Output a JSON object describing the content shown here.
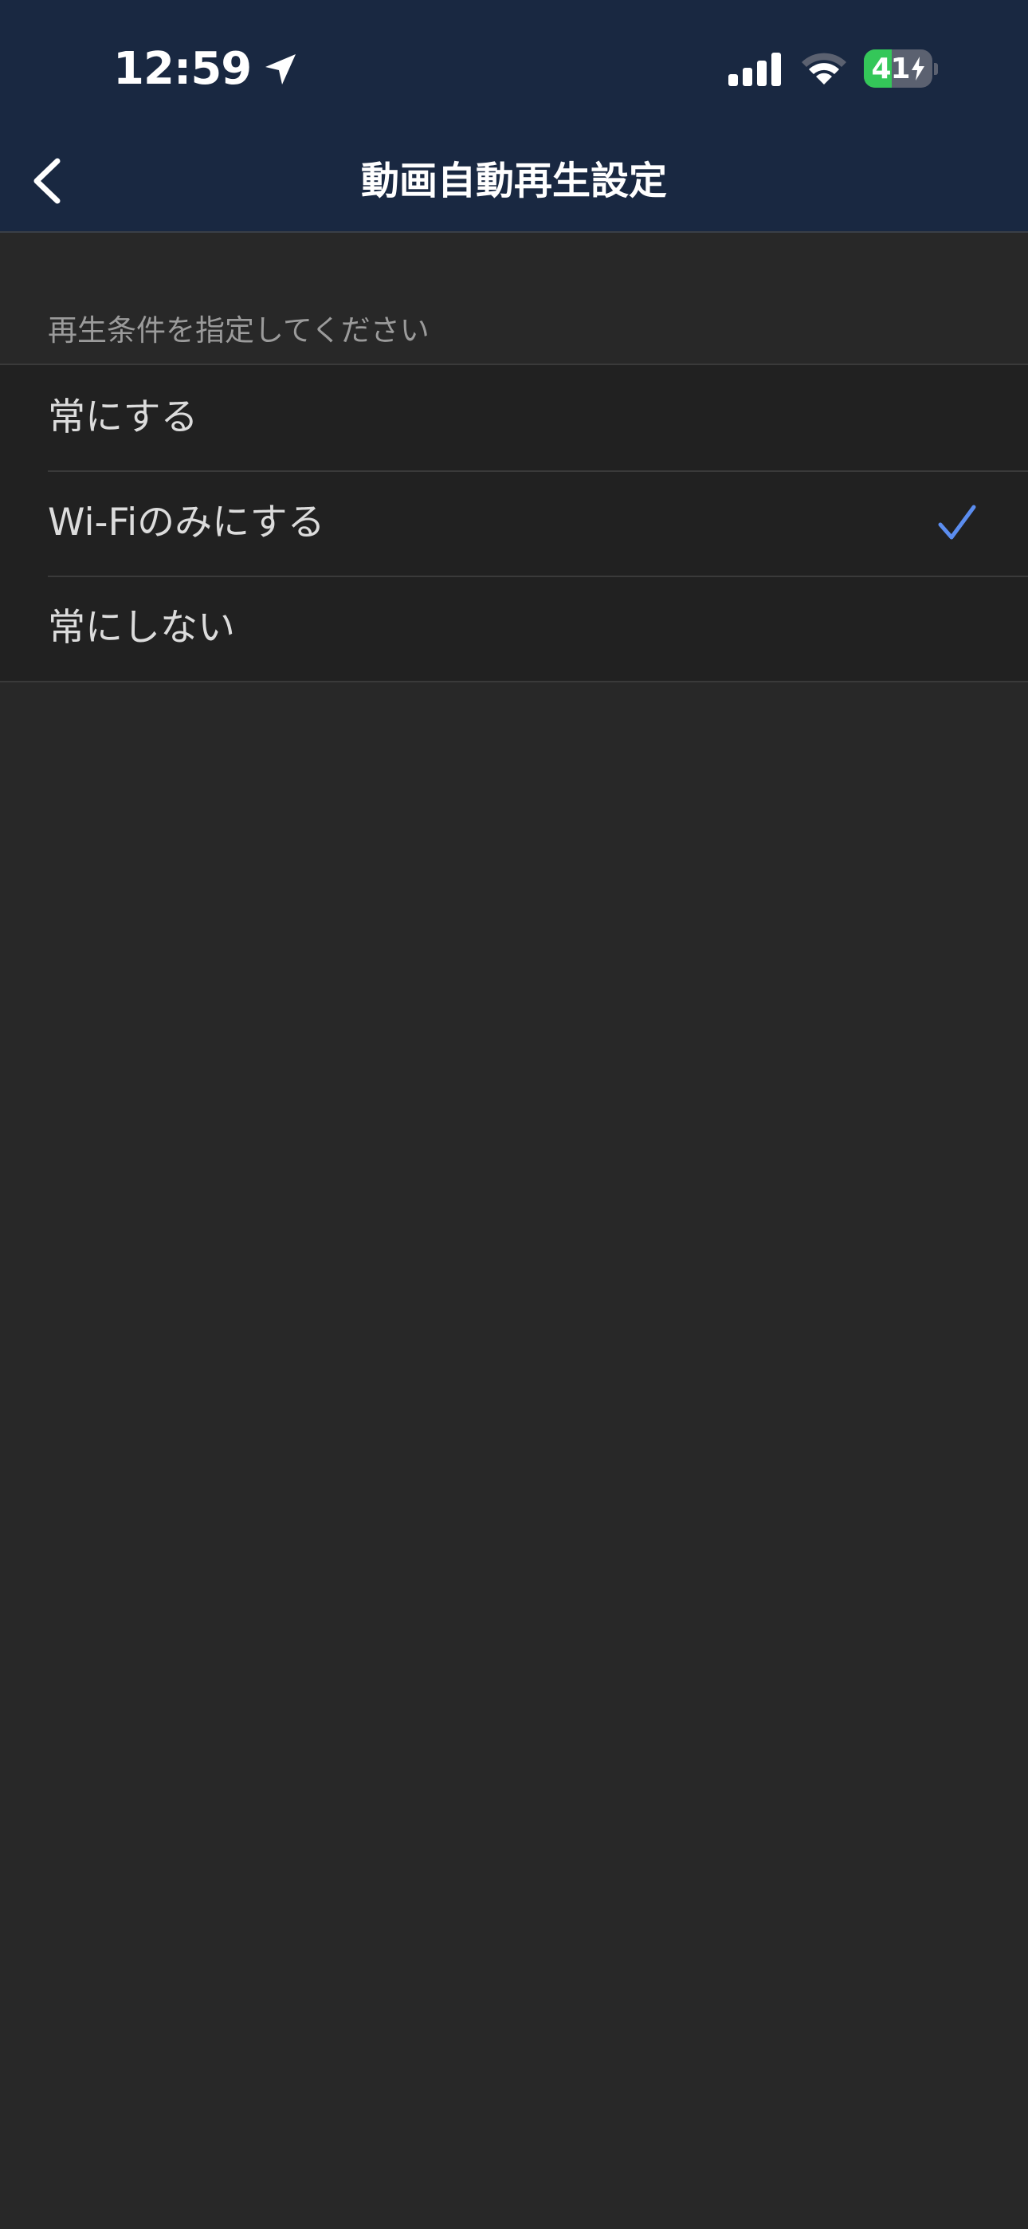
{
  "status_bar": {
    "time": "12:59",
    "battery_level": "41",
    "battery_fraction": 0.41,
    "icons": [
      "location-arrow-icon",
      "cellular-signal-icon",
      "wifi-icon",
      "battery-charging-icon"
    ]
  },
  "nav": {
    "title": "動画自動再生設定",
    "back_icon": "chevron-left-icon"
  },
  "section": {
    "header": "再生条件を指定してください"
  },
  "options": [
    {
      "label": "常にする",
      "selected": false
    },
    {
      "label": "Wi-Fiのみにする",
      "selected": true
    },
    {
      "label": "常にしない",
      "selected": false
    }
  ],
  "colors": {
    "nav_background": "#192841",
    "page_background": "#282828",
    "list_background": "#212121",
    "check_accent": "#5b8def",
    "battery_green": "#34c759"
  }
}
